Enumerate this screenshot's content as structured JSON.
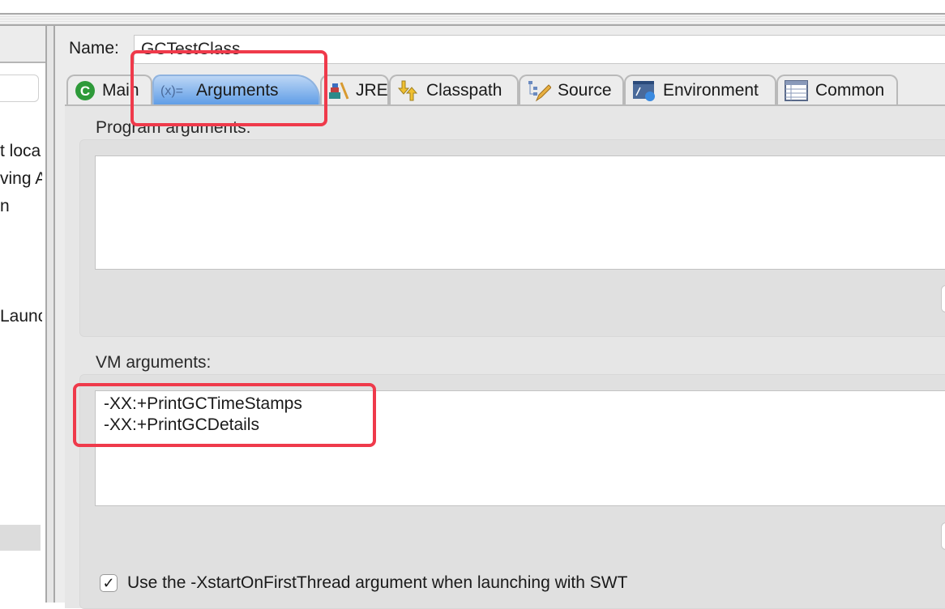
{
  "left_panel": {
    "lines": [
      "t loca",
      "ving A",
      "n",
      "Launc"
    ]
  },
  "name": {
    "label": "Name:",
    "value": "GCTestClass"
  },
  "tabs": [
    {
      "label": "Main",
      "icon": "main-class-icon",
      "selected": false
    },
    {
      "label": "Arguments",
      "icon": "arguments-icon",
      "selected": true
    },
    {
      "label": "JRE",
      "icon": "jre-library-icon",
      "selected": false
    },
    {
      "label": "Classpath",
      "icon": "classpath-icon",
      "selected": false
    },
    {
      "label": "Source",
      "icon": "source-icon",
      "selected": false
    },
    {
      "label": "Environment",
      "icon": "environment-icon",
      "selected": false
    },
    {
      "label": "Common",
      "icon": "common-icon",
      "selected": false
    }
  ],
  "program_arguments": {
    "label": "Program arguments:",
    "value": ""
  },
  "vm_arguments": {
    "label": "VM arguments:",
    "value": "-XX:+PrintGCTimeStamps\n-XX:+PrintGCDetails"
  },
  "checkbox": {
    "label": "Use the -XstartOnFirstThread argument when launching with SWT",
    "checked": true,
    "mark": "✓"
  },
  "colors": {
    "highlight": "#ef3a4b",
    "selected_tab": "#5d9ce6"
  }
}
